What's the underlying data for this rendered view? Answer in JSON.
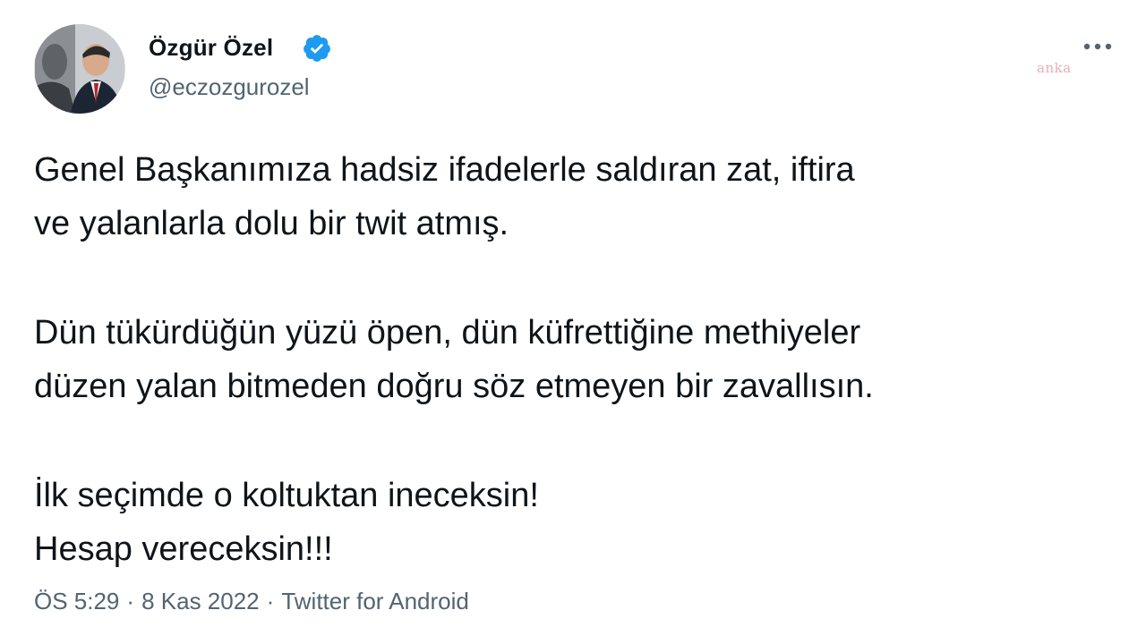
{
  "author": {
    "display_name": "Özgür Özel",
    "handle": "@eczozgurozel"
  },
  "watermark": "anka",
  "tweet": {
    "paragraphs": [
      [
        "Genel Başkanımıza hadsiz ifadelerle saldıran zat, iftira",
        "ve yalanlarla dolu bir twit atmış."
      ],
      [
        "Dün tükürdüğün yüzü öpen, dün küfrettiğine methiyeler",
        "düzen yalan bitmeden doğru söz etmeyen bir zavallısın."
      ],
      [
        "İlk seçimde o koltuktan ineceksin!",
        "Hesap vereceksin!!!"
      ]
    ]
  },
  "meta": {
    "time": "ÖS 5:29",
    "date": "8 Kas 2022",
    "source": "Twitter for Android",
    "separator": "·"
  },
  "icons": {
    "verified": "verified-badge-icon",
    "more": "more-options-icon"
  },
  "colors": {
    "verified_blue": "#1d9bf0",
    "text_primary": "#0f1419",
    "text_secondary": "#536471"
  }
}
